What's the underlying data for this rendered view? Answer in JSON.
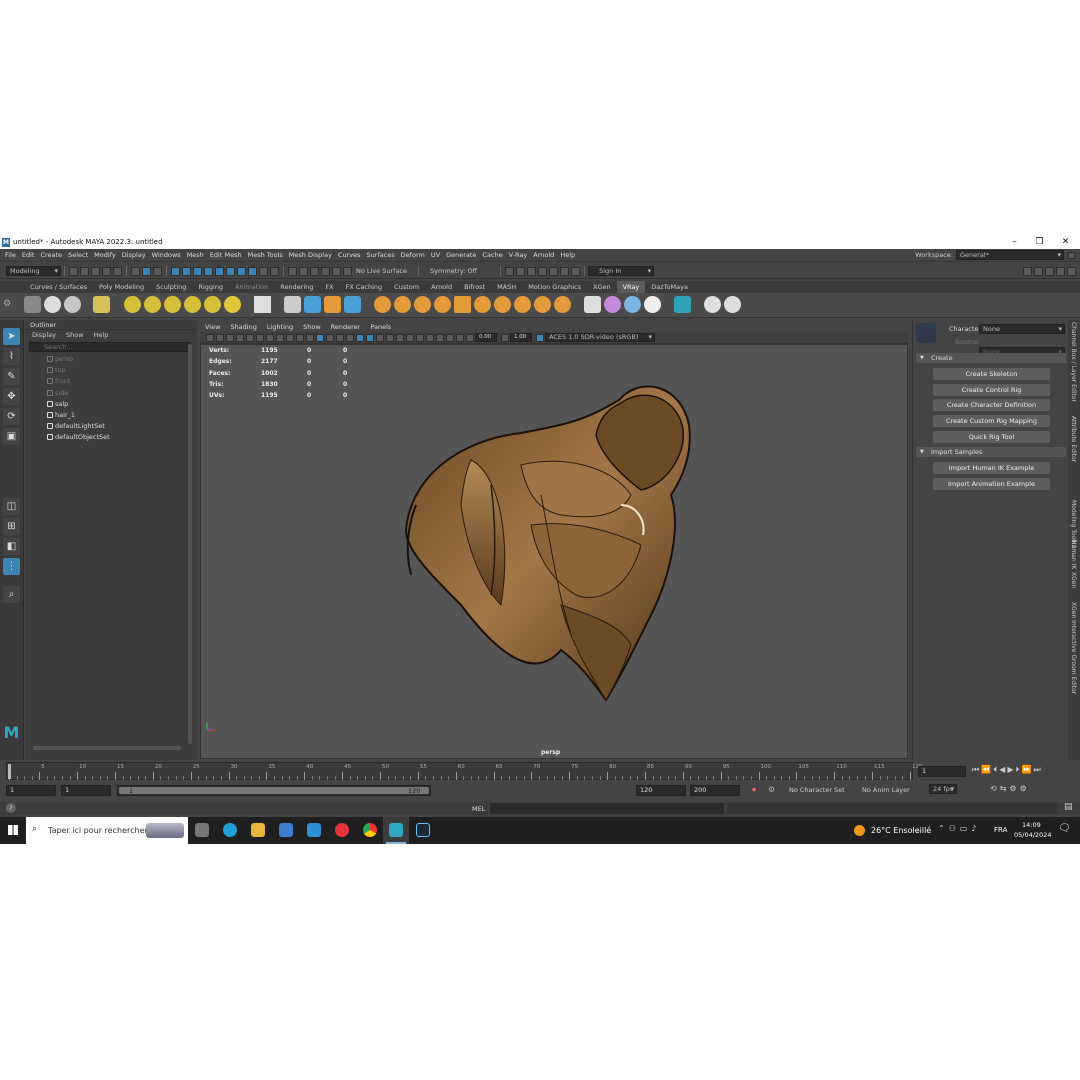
{
  "window": {
    "title": "untitled* - Autodesk MAYA 2022.3: untitled",
    "minimize": "–",
    "maximize": "❐",
    "close": "✕"
  },
  "menu": [
    "File",
    "Edit",
    "Create",
    "Select",
    "Modify",
    "Display",
    "Windows",
    "Mesh",
    "Edit Mesh",
    "Mesh Tools",
    "Mesh Display",
    "Curves",
    "Surfaces",
    "Deform",
    "UV",
    "Generate",
    "Cache",
    "V-Ray",
    "Arnold",
    "Help"
  ],
  "workspace": {
    "label": "Workspace:",
    "value": "General*"
  },
  "status_line": {
    "menu_set": "Modeling",
    "live_surface": "No Live Surface",
    "symmetry": "Symmetry: Off",
    "sign_in": "Sign In"
  },
  "shelf_tabs": [
    "Curves / Surfaces",
    "Poly Modeling",
    "Sculpting",
    "Rigging",
    "Animation",
    "Rendering",
    "FX",
    "FX Caching",
    "Custom",
    "Arnold",
    "Bifrost",
    "MASH",
    "Motion Graphics",
    "XGen",
    "VRay",
    "DazToMaya"
  ],
  "shelf_active": "VRay",
  "outliner": {
    "title": "Outliner",
    "menus": [
      "Display",
      "Show",
      "Help"
    ],
    "search_placeholder": "Search...",
    "items": [
      {
        "label": "persp",
        "dim": true
      },
      {
        "label": "top",
        "dim": true
      },
      {
        "label": "front",
        "dim": true
      },
      {
        "label": "side",
        "dim": true
      },
      {
        "label": "salp",
        "dim": false
      },
      {
        "label": "hair_1",
        "dim": false
      },
      {
        "label": "defaultLightSet",
        "dim": false
      },
      {
        "label": "defaultObjectSet",
        "dim": false
      }
    ]
  },
  "viewport": {
    "menus": [
      "View",
      "Shading",
      "Lighting",
      "Show",
      "Renderer",
      "Panels"
    ],
    "exposure": "0.00",
    "gamma": "1.00",
    "color_space": "ACES 1.0 SDR-video (sRGB)",
    "camera_label": "persp",
    "hud": [
      {
        "label": "Verts:",
        "v1": "1195",
        "v2": "0",
        "v3": "0"
      },
      {
        "label": "Edges:",
        "v1": "2177",
        "v2": "0",
        "v3": "0"
      },
      {
        "label": "Faces:",
        "v1": "1002",
        "v2": "0",
        "v3": "0"
      },
      {
        "label": "Tris:",
        "v1": "1830",
        "v2": "0",
        "v3": "0"
      },
      {
        "label": "UVs:",
        "v1": "1195",
        "v2": "0",
        "v3": "0"
      }
    ]
  },
  "human_ik": {
    "character_label": "Character:",
    "character_value": "None",
    "source_label": "Source:",
    "source_value": "None",
    "create_section": "Create",
    "create_buttons": [
      "Create Skeleton",
      "Create Control Rig",
      "Create Character Definition",
      "Create Custom Rig Mapping",
      "Quick Rig Tool"
    ],
    "import_section": "Import Samples",
    "import_buttons": [
      "Import Human IK Example",
      "Import Animation Example"
    ]
  },
  "side_tabs": [
    "Channel Box / Layer Editor",
    "Attribute Editor",
    "Modeling Toolkit",
    "Human IK",
    "XGen",
    "XGen Interactive Groom Editor"
  ],
  "timeline": {
    "ticks": [
      1,
      5,
      10,
      15,
      20,
      25,
      30,
      35,
      40,
      45,
      50,
      55,
      60,
      65,
      70,
      75,
      80,
      85,
      90,
      95,
      100,
      105,
      110,
      115,
      120
    ],
    "tick_labels": [
      "5",
      "10",
      "15",
      "20",
      "25",
      "30",
      "35",
      "40",
      "45",
      "50",
      "55",
      "60",
      "65",
      "70",
      "75",
      "80",
      "85",
      "90",
      "95",
      "100",
      "105",
      "110",
      "115",
      "120"
    ],
    "current_frame": "1"
  },
  "range": {
    "start": "1",
    "inner_start": "1",
    "slider_start": "1",
    "slider_end": "120",
    "end": "120",
    "anim_end": "200",
    "character_set": "No Character Set",
    "anim_layer": "No Anim Layer",
    "fps": "24 fps"
  },
  "command": {
    "mode": "MEL",
    "help": "?"
  },
  "taskbar": {
    "search": "Taper ici pour rechercher",
    "weather": "26°C  Ensoleillé",
    "lang": "FRA",
    "time": "14:09",
    "date": "05/04/2024"
  },
  "colors": {
    "accent": "#3c84b6",
    "ui_bg": "#444444",
    "viewport_bg": "#555555",
    "hair_brown": "#8a6239"
  }
}
